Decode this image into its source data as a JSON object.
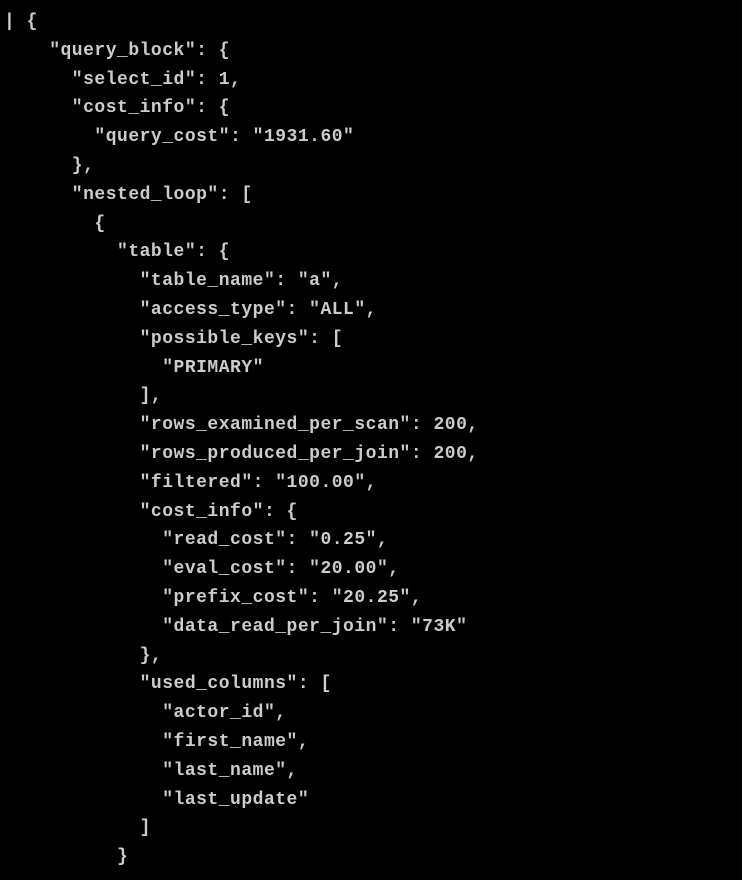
{
  "code_lines": [
    "| {",
    "    \"query_block\": {",
    "      \"select_id\": 1,",
    "      \"cost_info\": {",
    "        \"query_cost\": \"1931.60\"",
    "      },",
    "      \"nested_loop\": [",
    "        {",
    "          \"table\": {",
    "            \"table_name\": \"a\",",
    "            \"access_type\": \"ALL\",",
    "            \"possible_keys\": [",
    "              \"PRIMARY\"",
    "            ],",
    "            \"rows_examined_per_scan\": 200,",
    "            \"rows_produced_per_join\": 200,",
    "            \"filtered\": \"100.00\",",
    "            \"cost_info\": {",
    "              \"read_cost\": \"0.25\",",
    "              \"eval_cost\": \"20.00\",",
    "              \"prefix_cost\": \"20.25\",",
    "              \"data_read_per_join\": \"73K\"",
    "            },",
    "            \"used_columns\": [",
    "              \"actor_id\",",
    "              \"first_name\",",
    "              \"last_name\",",
    "              \"last_update\"",
    "            ]",
    "          }"
  ]
}
